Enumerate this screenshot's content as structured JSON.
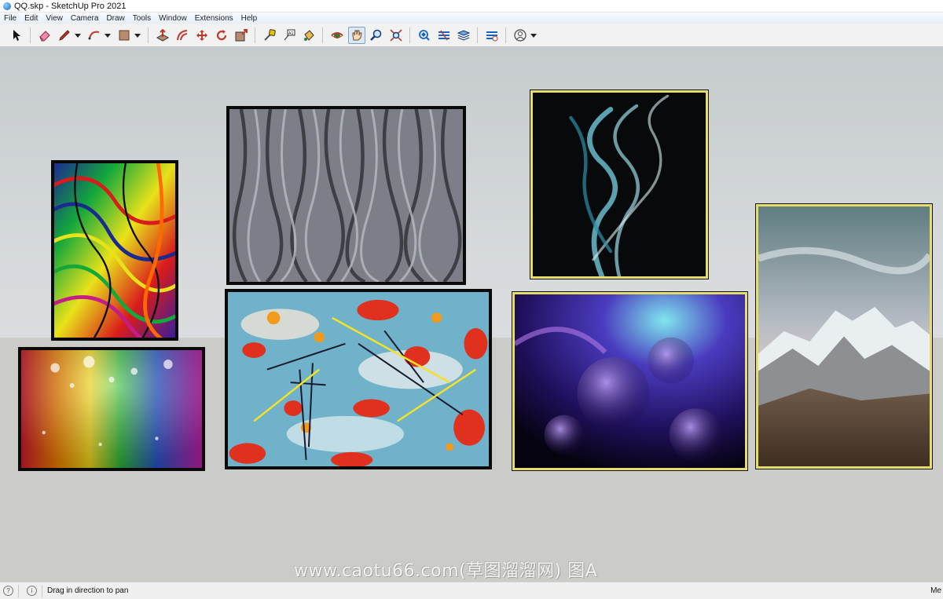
{
  "window": {
    "title": "QQ.skp - SketchUp Pro 2021"
  },
  "menu": [
    "File",
    "Edit",
    "View",
    "Camera",
    "Draw",
    "Tools",
    "Window",
    "Extensions",
    "Help"
  ],
  "toolbar": {
    "tools": [
      {
        "name": "select-tool",
        "icon": "arrow-cursor-icon"
      },
      {
        "name": "eraser-tool",
        "icon": "eraser-icon"
      },
      {
        "name": "line-tool",
        "icon": "pencil-icon",
        "dropdown": true
      },
      {
        "name": "arc-tool",
        "icon": "arc-icon",
        "dropdown": true
      },
      {
        "name": "rectangle-tool",
        "icon": "rectangle-icon",
        "dropdown": true
      },
      {
        "name": "push-pull-tool",
        "icon": "push-pull-icon"
      },
      {
        "name": "offset-tool",
        "icon": "offset-icon"
      },
      {
        "name": "move-tool",
        "icon": "move-icon"
      },
      {
        "name": "rotate-tool",
        "icon": "rotate-icon"
      },
      {
        "name": "scale-tool",
        "icon": "scale-icon"
      },
      {
        "name": "tape-measure-tool",
        "icon": "tape-measure-icon"
      },
      {
        "name": "text-tool",
        "icon": "text-icon"
      },
      {
        "name": "paint-bucket-tool",
        "icon": "paint-bucket-icon"
      },
      {
        "name": "orbit-tool",
        "icon": "orbit-icon"
      },
      {
        "name": "pan-tool",
        "icon": "hand-icon",
        "active": true
      },
      {
        "name": "zoom-tool",
        "icon": "magnifier-icon"
      },
      {
        "name": "zoom-extents-tool",
        "icon": "zoom-extents-icon"
      },
      {
        "name": "warehouse-tool",
        "icon": "warehouse-icon"
      },
      {
        "name": "extension-warehouse-tool",
        "icon": "extension-warehouse-icon"
      },
      {
        "name": "layout-tool",
        "icon": "layers-icon"
      },
      {
        "name": "extension-manager-tool",
        "icon": "extension-manager-icon"
      },
      {
        "name": "account-tool",
        "icon": "user-circle-icon",
        "dropdown": true
      }
    ]
  },
  "viewport": {
    "frames": [
      {
        "name": "frame-psychedelic-swirls",
        "border": "black"
      },
      {
        "name": "frame-tree-bark",
        "border": "black"
      },
      {
        "name": "frame-smoke",
        "border": "yellow"
      },
      {
        "name": "frame-rainbow-glitter",
        "border": "black"
      },
      {
        "name": "frame-abstract-paint",
        "border": "black"
      },
      {
        "name": "frame-purple-bubbles",
        "border": "yellow"
      },
      {
        "name": "frame-snowy-mountain",
        "border": "yellow"
      }
    ],
    "watermark": "www.caotu66.com(草图溜溜网) 图A"
  },
  "status": {
    "hint": "Drag in direction to pan",
    "measurements_label": "Me"
  },
  "colors": {
    "frame_black": "#0a0a0a",
    "frame_yellow": "#e6dd6a",
    "sky_top": "#c6cbce",
    "ground": "#cbccc8"
  }
}
